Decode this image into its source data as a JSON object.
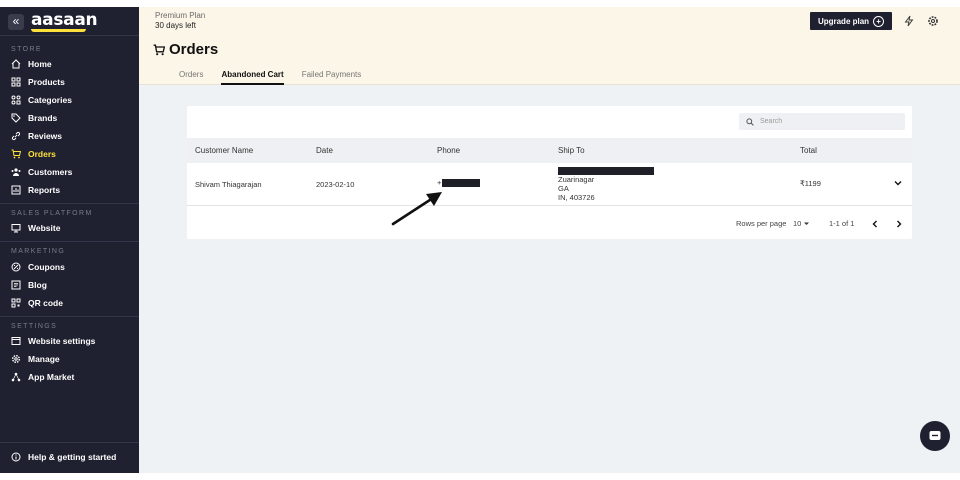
{
  "brand": {
    "logo": "aasaan",
    "accent": "#ffe13b",
    "dark": "#1f2030"
  },
  "sidebar": {
    "collapse_icon": "«",
    "sections": [
      {
        "label": "STORE",
        "items": [
          {
            "label": "Home",
            "icon": "home-icon"
          },
          {
            "label": "Products",
            "icon": "grid-icon"
          },
          {
            "label": "Categories",
            "icon": "categories-icon"
          },
          {
            "label": "Brands",
            "icon": "tag-icon"
          },
          {
            "label": "Reviews",
            "icon": "link-icon"
          },
          {
            "label": "Orders",
            "icon": "cart-icon",
            "active": true
          },
          {
            "label": "Customers",
            "icon": "users-icon"
          },
          {
            "label": "Reports",
            "icon": "chart-icon"
          }
        ]
      },
      {
        "label": "SALES PLATFORM",
        "items": [
          {
            "label": "Website",
            "icon": "monitor-icon"
          }
        ]
      },
      {
        "label": "MARKETING",
        "items": [
          {
            "label": "Coupons",
            "icon": "coupon-icon"
          },
          {
            "label": "Blog",
            "icon": "blog-icon"
          },
          {
            "label": "QR code",
            "icon": "qr-icon"
          }
        ]
      },
      {
        "label": "SETTINGS",
        "items": [
          {
            "label": "Website settings",
            "icon": "settings-window-icon"
          },
          {
            "label": "Manage",
            "icon": "gear-icon"
          },
          {
            "label": "App Market",
            "icon": "apps-icon"
          }
        ]
      }
    ],
    "help": "Help & getting started"
  },
  "header": {
    "plan_name": "Premium Plan",
    "plan_days": "30 days left",
    "upgrade_label": "Upgrade plan",
    "page_title": "Orders",
    "tabs": [
      {
        "label": "Orders",
        "active": false
      },
      {
        "label": "Abandoned Cart",
        "active": true
      },
      {
        "label": "Failed Payments",
        "active": false
      }
    ]
  },
  "table": {
    "search_placeholder": "Search",
    "columns": [
      "Customer Name",
      "Date",
      "Phone",
      "Ship To",
      "Total"
    ],
    "rows": [
      {
        "customer": "Shivam Thiagarajan",
        "date": "2023-02-10",
        "phone_prefix": "+",
        "ship_to": [
          "Zuarinagar",
          "GA",
          "IN, 403726"
        ],
        "total": "₹1199"
      }
    ],
    "footer": {
      "rows_per_page_label": "Rows per page",
      "rows_per_page": "10",
      "range": "1-1 of 1"
    }
  }
}
